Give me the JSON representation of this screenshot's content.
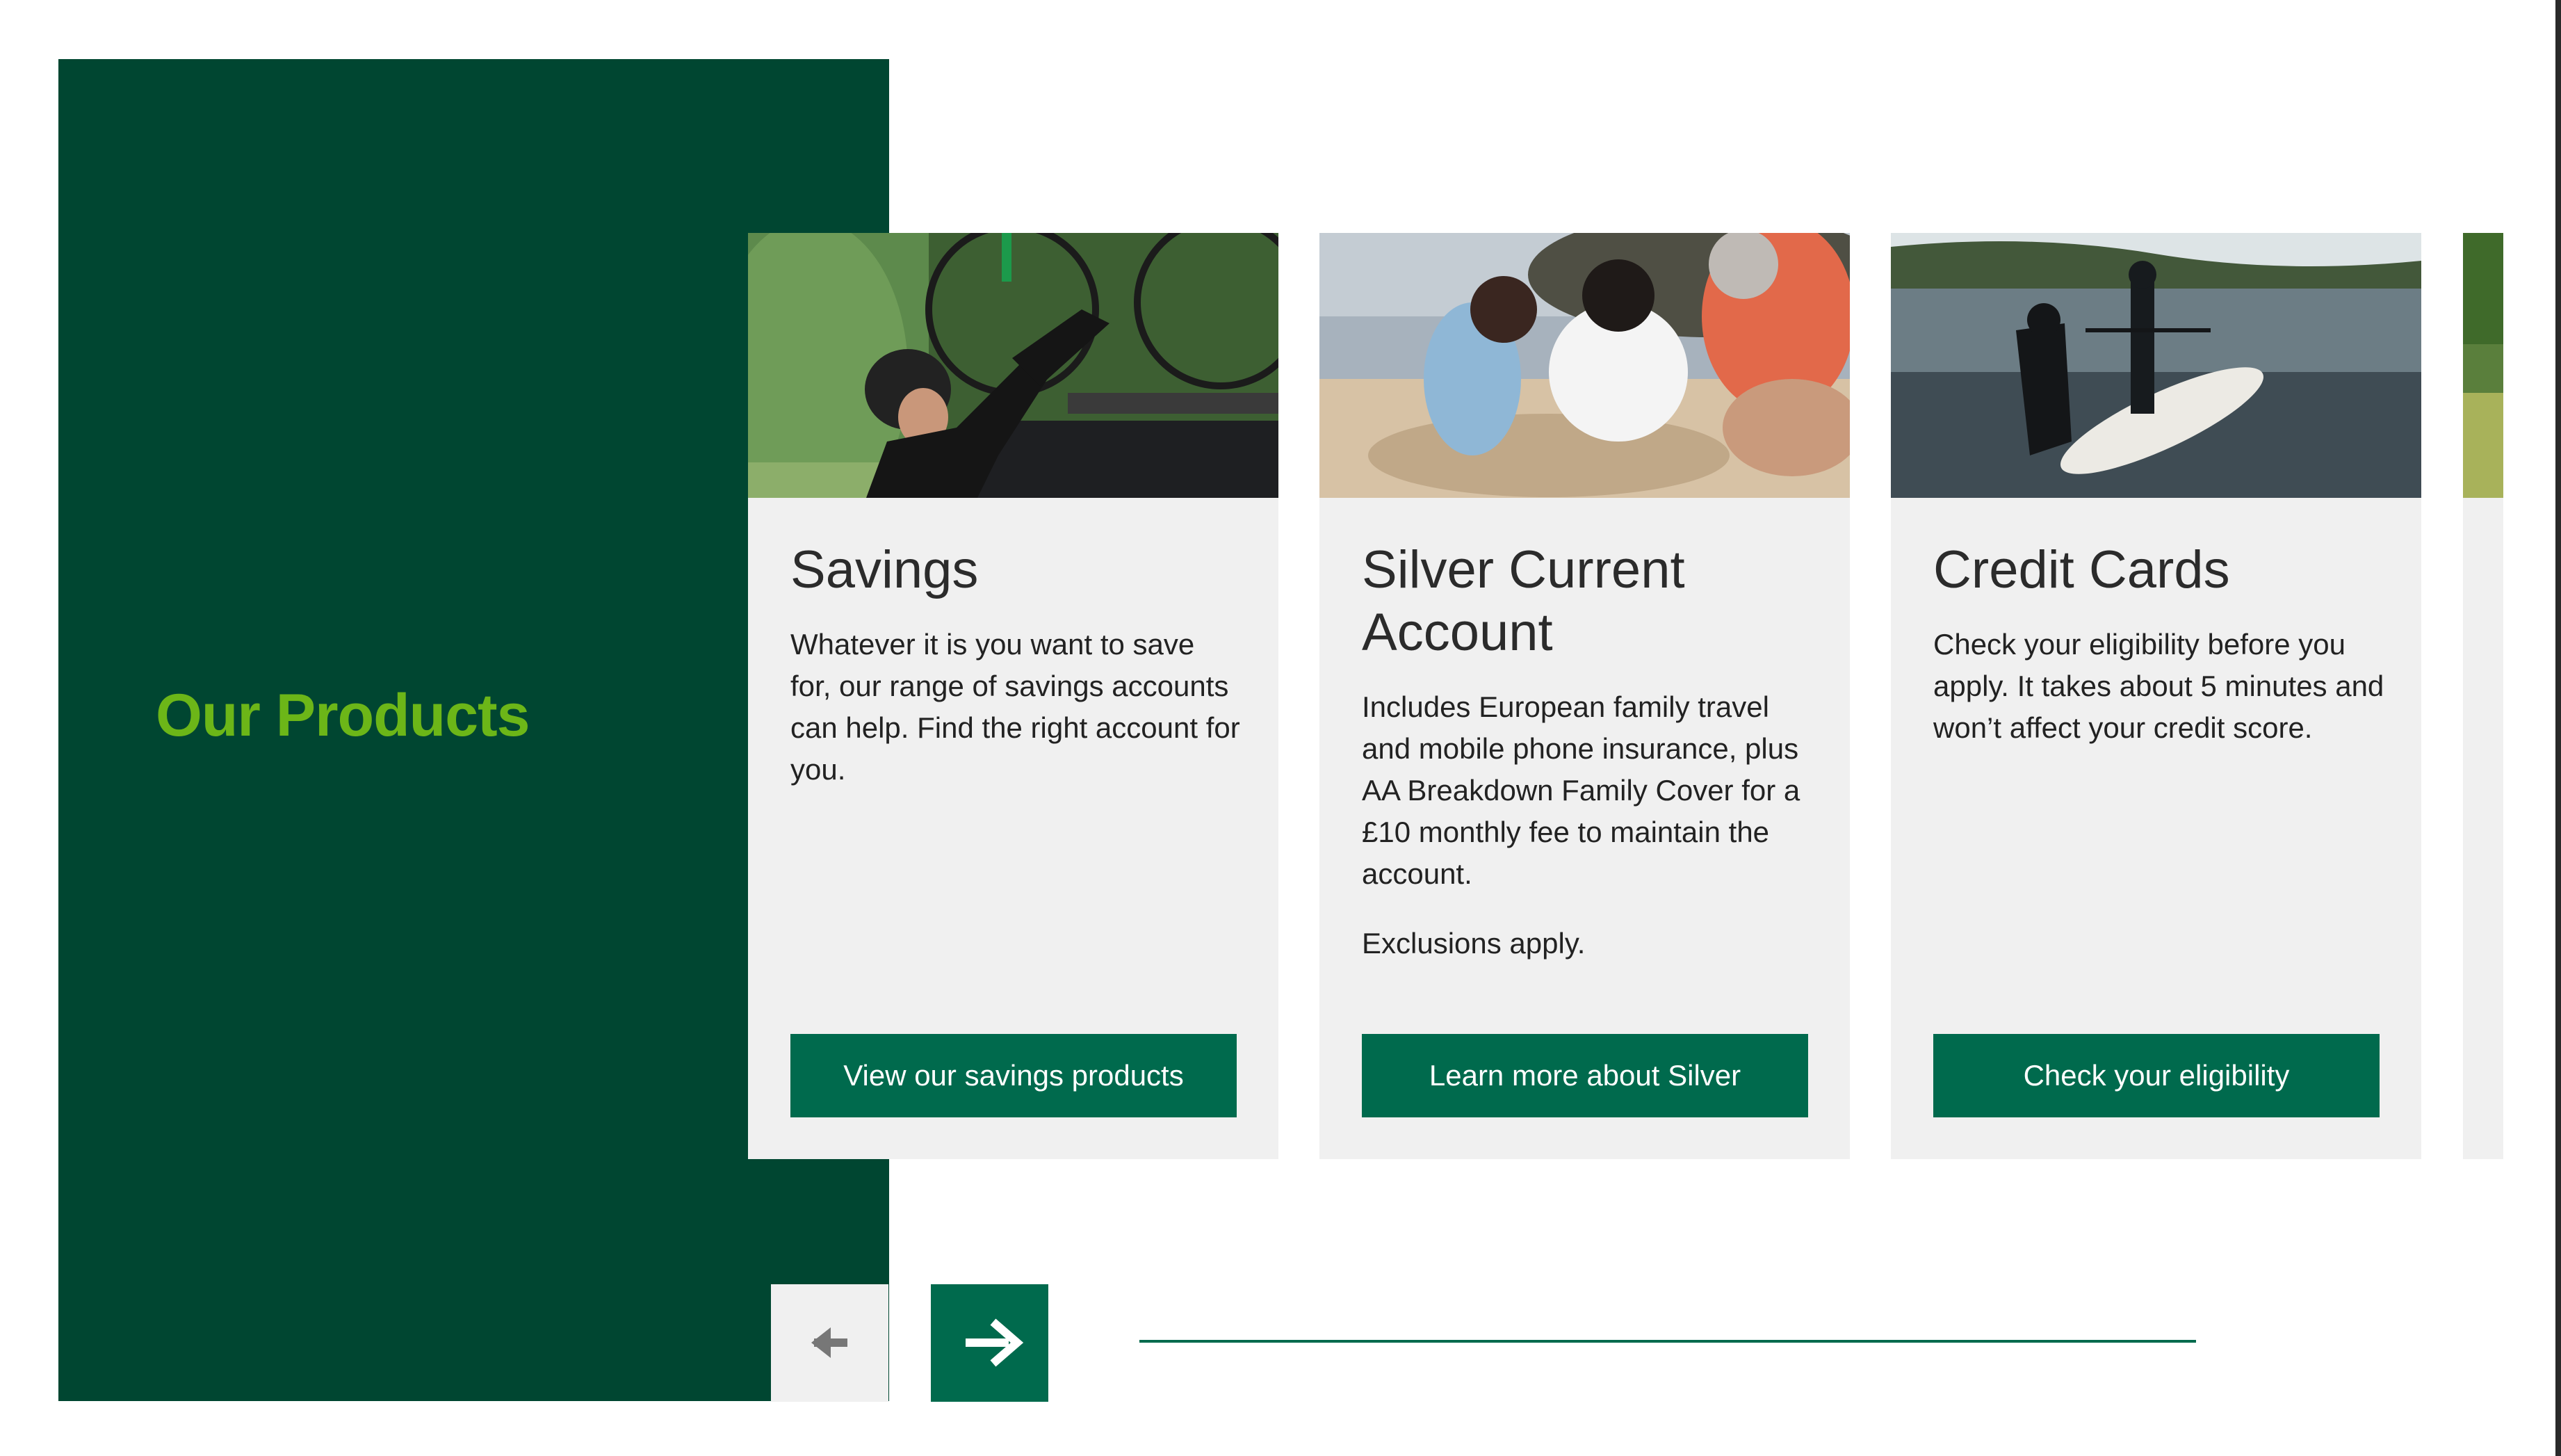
{
  "section": {
    "title": "Our Products"
  },
  "cards": [
    {
      "title": "Savings",
      "description": "Whatever it is you want to save for, our range of savings accounts can help. Find the right account for you.",
      "note": "",
      "button_label": "View our savings products"
    },
    {
      "title": "Silver Current Account",
      "description": "Includes European family travel and mobile phone insurance, plus AA Breakdown Family Cover for a £10 monthly fee to maintain the account.",
      "note": "Exclusions apply.",
      "button_label": "Learn more about Silver"
    },
    {
      "title": "Credit Cards",
      "description": "Check your eligibility before you apply. It takes about 5 minutes and won’t affect your credit score.",
      "note": "",
      "button_label": "Check your eligibility"
    }
  ],
  "carousel": {
    "prev_icon": "arrow-left-icon",
    "next_icon": "arrow-right-icon"
  },
  "colors": {
    "panel": "#004631",
    "title_accent": "#6cb618",
    "button": "#006a4d",
    "card_bg": "#f0f0f0"
  }
}
